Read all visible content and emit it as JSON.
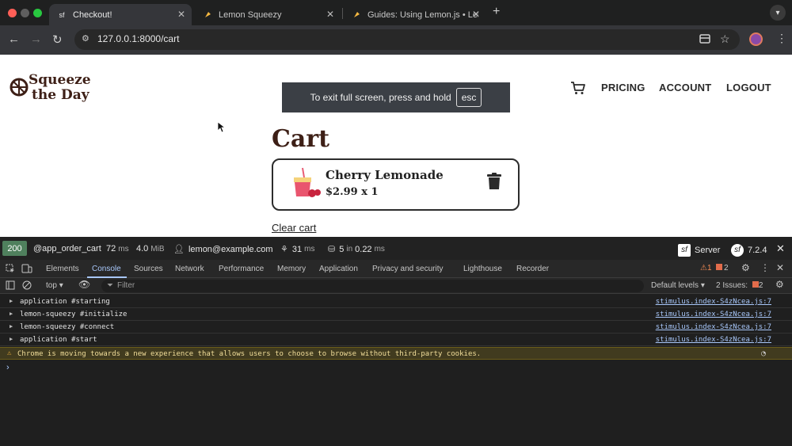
{
  "browser": {
    "tabs": [
      {
        "title": "Checkout!",
        "favicon": "sf",
        "active": true
      },
      {
        "title": "Lemon Squeezy",
        "favicon": "lemon-icon"
      },
      {
        "title": "Guides: Using Lemon.js • Lem",
        "favicon": "lemon-icon"
      }
    ],
    "url": "127.0.0.1:8000/cart",
    "new_tab": "+"
  },
  "site": {
    "logo_line1": "Squeeze",
    "logo_line2": "the Day",
    "nav": {
      "pricing": "PRICING",
      "account": "ACCOUNT",
      "logout": "LOGOUT"
    },
    "fullscreen_notice": "To exit full screen, press and hold",
    "fullscreen_key": "esc",
    "cart_title": "Cart",
    "cart_items": [
      {
        "name": "Cherry Lemonade",
        "price_line": "$2.99 x 1"
      }
    ],
    "clear_cart": "Clear cart"
  },
  "symfony_bar": {
    "status": "200",
    "route": "@app_order_cart",
    "time_value": "72",
    "time_unit": "ms",
    "memory_value": "4.0",
    "memory_unit": "MiB",
    "user": "lemon@example.com",
    "twig_value": "31",
    "twig_unit": "ms",
    "db_queries": "5",
    "db_in": "in",
    "db_time": "0.22",
    "db_unit": "ms",
    "server_label": "Server",
    "version": "7.2.4",
    "status_color": "#4f805d"
  },
  "devtools": {
    "tabs": [
      "Elements",
      "Console",
      "Sources",
      "Network",
      "Performance",
      "Memory",
      "Application",
      "Privacy and security",
      "Lighthouse",
      "Recorder"
    ],
    "active_tab": "Console",
    "warnings_count": "1",
    "errors_count": "2",
    "context": "top",
    "filter_placeholder": "Filter",
    "levels": "Default levels",
    "issues_label": "2 Issues:",
    "issues_count": "2",
    "logs": [
      {
        "message": "application #starting",
        "source": "stimulus.index-S4zNcea.js:7"
      },
      {
        "message": "lemon-squeezy #initialize",
        "source": "stimulus.index-S4zNcea.js:7"
      },
      {
        "message": "lemon-squeezy #connect",
        "source": "stimulus.index-S4zNcea.js:7"
      },
      {
        "message": "application #start",
        "source": "stimulus.index-S4zNcea.js:7"
      }
    ],
    "warning": "Chrome is moving towards a new experience that allows users to choose to browse without third-party cookies.",
    "prompt": "›"
  }
}
